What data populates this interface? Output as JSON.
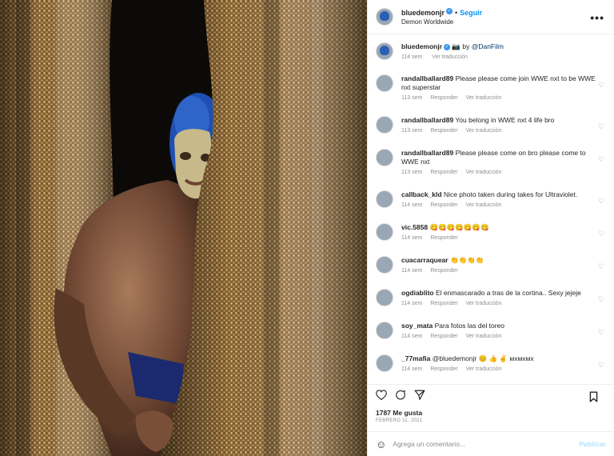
{
  "header": {
    "username": "bluedemonjr",
    "separator": "•",
    "follow_label": "Seguir",
    "location": "Demon Worldwide",
    "more": "•••"
  },
  "caption": {
    "username": "bluedemonjr",
    "text": "📷 by",
    "mention": "@DanFilm",
    "time": "114 sem",
    "translate": "Ver traducción"
  },
  "comments": [
    {
      "user": "randallballard89",
      "text": "Please please come join WWE nxt to be WWE nxt superstar",
      "time": "113 sem",
      "reply": "Responder",
      "translate": "Ver traducción"
    },
    {
      "user": "randallballard89",
      "text": "You belong in WWE nxt 4 life bro",
      "time": "113 sem",
      "reply": "Responder",
      "translate": "Ver traducción"
    },
    {
      "user": "randallballard89",
      "text": "Please please come on bro please come to WWE nxt",
      "time": "113 sem",
      "reply": "Responder",
      "translate": "Ver traducción"
    },
    {
      "user": "callback_kld",
      "text": "Nice photo taken during takes for Ultraviolet.",
      "time": "114 sem",
      "reply": "Responder",
      "translate": "Ver traducción"
    },
    {
      "user": "vic.5858",
      "text": "😋😋😋😋😋😋😋",
      "time": "114 sem",
      "reply": "Responder",
      "translate": ""
    },
    {
      "user": "cuacarraquear",
      "text": "👏👏👏👏",
      "time": "114 sem",
      "reply": "Responder",
      "translate": ""
    },
    {
      "user": "ogdiablito",
      "text": "El enmascarado a tras de la cortina.. Sexy jejeje",
      "time": "114 sem",
      "reply": "Responder",
      "translate": "Ver traducción"
    },
    {
      "user": "soy_mata",
      "text": "Para fotos las del toreo",
      "time": "114 sem",
      "reply": "Responder",
      "translate": "Ver traducción"
    },
    {
      "user": "_77mafia",
      "text": "@bluedemonjr 😊 👍 ✌ мхмхмх",
      "time": "114 sem",
      "reply": "Responder",
      "translate": "Ver traducción"
    }
  ],
  "actions": {
    "like_icon": "heart-icon",
    "comment_icon": "comment-icon",
    "share_icon": "send-icon",
    "save_icon": "bookmark-icon"
  },
  "likes": "1787 Me gusta",
  "date": "FEBRERO 11, 2021",
  "add_comment": {
    "emoji_icon": "☺",
    "placeholder": "Agrega un comentario...",
    "post_label": "Publicar"
  },
  "colors": {
    "accent": "#0095f6",
    "post_disabled": "#b2dffc",
    "mask_blue": "#2a5fb8",
    "curtain_gold": "#b88d4a"
  }
}
